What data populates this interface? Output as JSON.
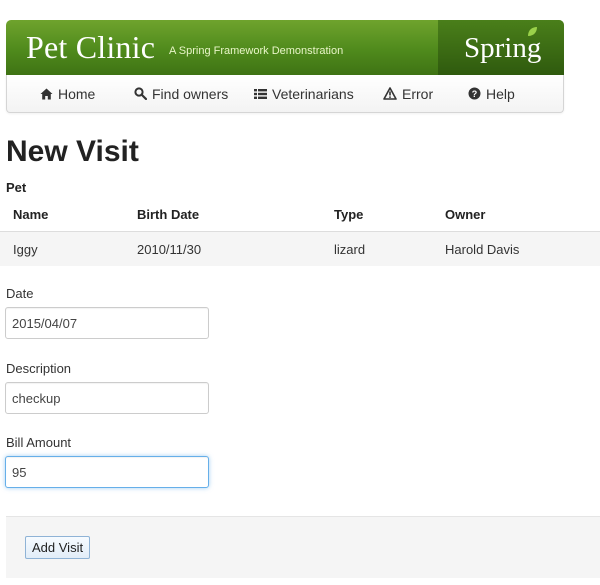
{
  "header": {
    "title": "Pet Clinic",
    "tagline": "A Spring Framework Demonstration",
    "logo_text": "Spring",
    "colors": {
      "brand_green": "#4f8a1c",
      "brand_dark": "#2f5a0e",
      "leaf": "#9ad14a"
    }
  },
  "nav": {
    "items": [
      {
        "label": "Home",
        "icon": "home-icon"
      },
      {
        "label": "Find owners",
        "icon": "search-icon"
      },
      {
        "label": "Veterinarians",
        "icon": "list-icon"
      },
      {
        "label": "Error",
        "icon": "warning-icon"
      },
      {
        "label": "Help",
        "icon": "help-icon"
      }
    ]
  },
  "page": {
    "title": "New Visit",
    "pet_section": "Pet"
  },
  "pet_table": {
    "columns": [
      "Name",
      "Birth Date",
      "Type",
      "Owner"
    ],
    "rows": [
      [
        "Iggy",
        "2010/11/30",
        "lizard",
        "Harold Davis"
      ]
    ]
  },
  "form": {
    "date_label": "Date",
    "date_value": "2015/04/07",
    "description_label": "Description",
    "description_value": "checkup",
    "bill_label": "Bill Amount",
    "bill_value": "95",
    "submit_label": "Add Visit",
    "focus_color": "#66afe9"
  }
}
